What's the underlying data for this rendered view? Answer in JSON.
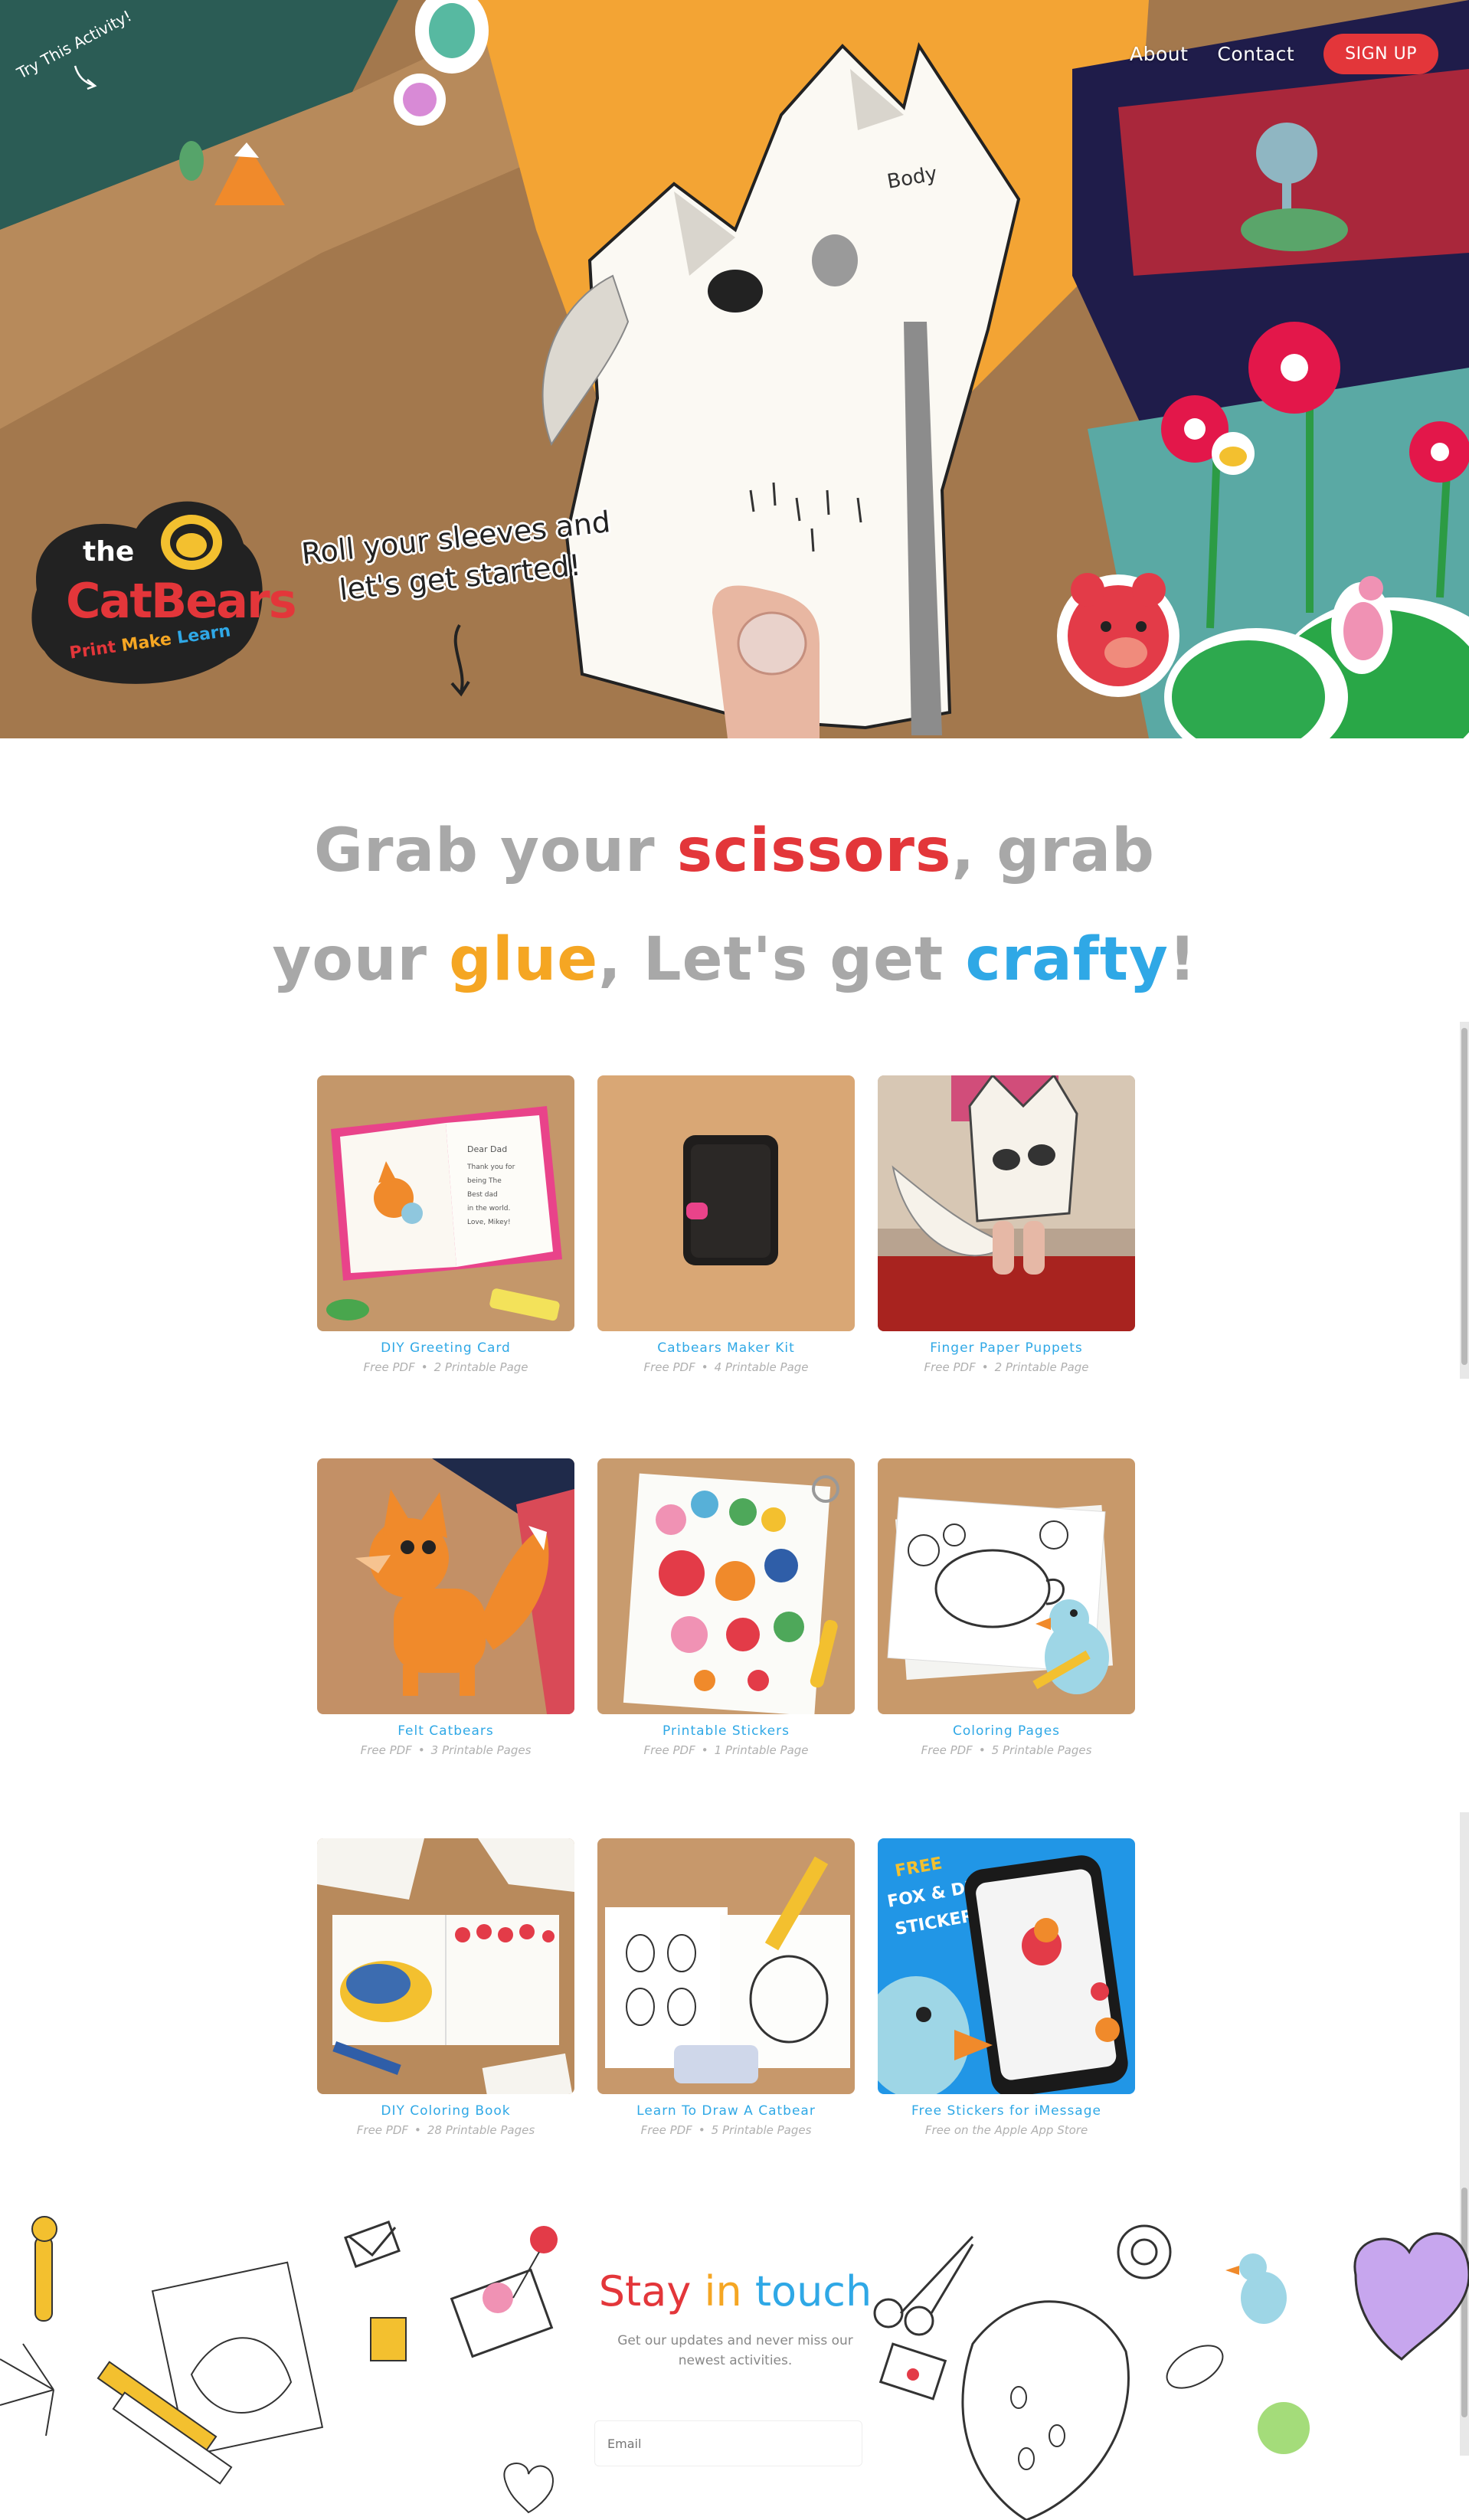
{
  "nav": {
    "about": "About",
    "contact": "Contact",
    "signup": "SIGN UP"
  },
  "hero": {
    "try_activity": "Try This Activity!",
    "speech": "Roll your sleeves and let's get started!",
    "paper_label": "Body",
    "logo": {
      "the": "the",
      "name": "CatBears",
      "tag": [
        "Print",
        "Make",
        "Learn"
      ]
    }
  },
  "headline": {
    "p1": "Grab your ",
    "scissors": "scissors",
    "p2": ", grab",
    "p3": "your ",
    "glue": "glue",
    "p4": ", Let's get ",
    "crafty": "crafty",
    "p5": "!"
  },
  "activities": [
    {
      "title": "DIY Greeting Card",
      "type": "Free PDF",
      "pages": "2 Printable Page",
      "card_text": "Dear Dad Thank you for being The Best dad in the world. Love, Mikey!"
    },
    {
      "title": "Catbears Maker Kit",
      "type": "Free PDF",
      "pages": "4 Printable Page"
    },
    {
      "title": "Finger Paper Puppets",
      "type": "Free PDF",
      "pages": "2 Printable Page"
    },
    {
      "title": "Felt Catbears",
      "type": "Free PDF",
      "pages": "3 Printable Pages"
    },
    {
      "title": "Printable Stickers",
      "type": "Free PDF",
      "pages": "1 Printable Page"
    },
    {
      "title": "Coloring Pages",
      "type": "Free PDF",
      "pages": "5 Printable Pages"
    },
    {
      "title": "DIY Coloring Book",
      "type": "Free PDF",
      "pages": "28 Printable Pages"
    },
    {
      "title": "Learn To Draw A Catbear",
      "type": "Free PDF",
      "pages": "5 Printable Pages"
    },
    {
      "title": "Free Stickers for iMessage",
      "type": "Free on the Apple App Store",
      "pages": "",
      "promo": "FREE FOX & DUCK STICKERS"
    }
  ],
  "newsletter": {
    "stay": "Stay",
    "in": "in",
    "touch": "touch",
    "text": "Get our updates and never miss our newest activities.",
    "email_placeholder": "Email"
  },
  "colors": {
    "red": "#e3363a",
    "orange": "#f5a623",
    "blue": "#2fa8e6",
    "gray": "#a8a8a8"
  }
}
